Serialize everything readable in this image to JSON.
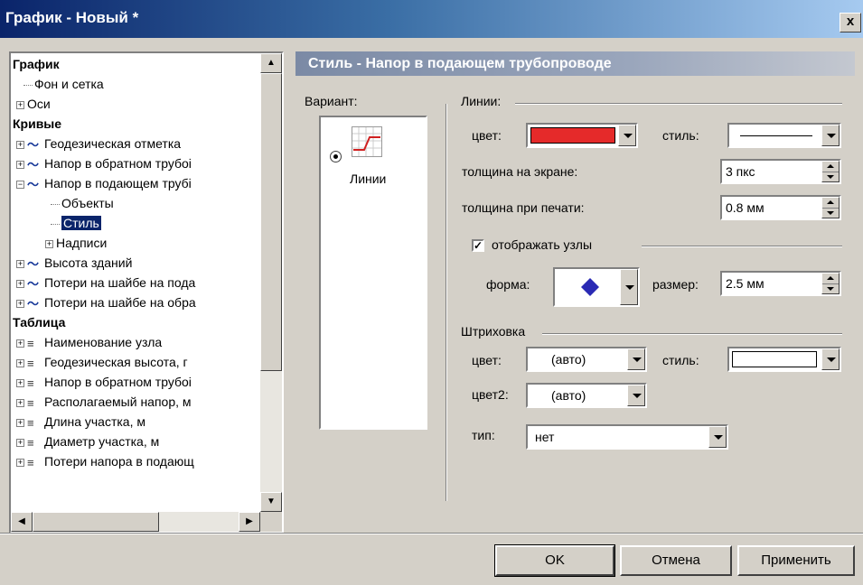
{
  "window": {
    "title": "График - Новый *",
    "close_glyph": "x"
  },
  "tree": {
    "rows": [
      {
        "label": "График",
        "bold": true
      },
      {
        "label": "Фон и сетка"
      },
      {
        "label": "Оси",
        "expander": "+"
      },
      {
        "label": "Кривые",
        "bold": true
      },
      {
        "label": "Геодезическая отметка",
        "expander": "+",
        "icon": "curve-icon"
      },
      {
        "label": "Напор в обратном трубоі",
        "expander": "+",
        "icon": "curve-icon"
      },
      {
        "label": "Напор в подающем трубі",
        "expander": "−",
        "icon": "curve-icon"
      },
      {
        "label": "Объекты"
      },
      {
        "label": "Стиль",
        "selected": true
      },
      {
        "label": "Надписи",
        "expander": "+"
      },
      {
        "label": "Высота зданий",
        "expander": "+",
        "icon": "curve-icon"
      },
      {
        "label": "Потери на шайбе на пода",
        "expander": "+",
        "icon": "curve-icon"
      },
      {
        "label": "Потери на шайбе на обра",
        "expander": "+",
        "icon": "curve-icon"
      },
      {
        "label": "Таблица",
        "bold": true
      },
      {
        "label": "Наименование узла",
        "expander": "+",
        "icon": "table-row-icon"
      },
      {
        "label": "Геодезическая высота, г",
        "expander": "+",
        "icon": "table-row-icon"
      },
      {
        "label": "Напор в обратном трубоі",
        "expander": "+",
        "icon": "table-row-icon"
      },
      {
        "label": "Располагаемый напор, м",
        "expander": "+",
        "icon": "table-row-icon"
      },
      {
        "label": "Длина участка, м",
        "expander": "+",
        "icon": "table-row-icon"
      },
      {
        "label": "Диаметр участка, м",
        "expander": "+",
        "icon": "table-row-icon"
      },
      {
        "label": "Потери напора в подающ",
        "expander": "+",
        "icon": "table-row-icon"
      }
    ]
  },
  "panel": {
    "header": "Стиль - Напор в подающем трубопроводе",
    "variant_label": "Вариант:",
    "variant_option": "Линии",
    "lines_group": "Линии:",
    "color_label": "цвет:",
    "line_color": "#e52a2a",
    "style_label": "стиль:",
    "thickness_screen_label": "толщина на экране:",
    "thickness_screen_value": "3 пкс",
    "thickness_print_label": "толщина при печати:",
    "thickness_print_value": "0.8 мм",
    "show_nodes_label": "отображать узлы",
    "show_nodes_checked": true,
    "shape_label": "форма:",
    "shape_color": "#2a2ab4",
    "size_label": "размер:",
    "size_value": "2.5 мм",
    "hatch_group": "Штриховка",
    "hatch_color_label": "цвет:",
    "hatch_color_value": "(авто)",
    "hatch_style_label": "стиль:",
    "hatch_color2_label": "цвет2:",
    "hatch_color2_value": "(авто)",
    "type_label": "тип:",
    "type_value": "нет"
  },
  "buttons": {
    "ok": "OK",
    "cancel": "Отмена",
    "apply": "Применить"
  }
}
